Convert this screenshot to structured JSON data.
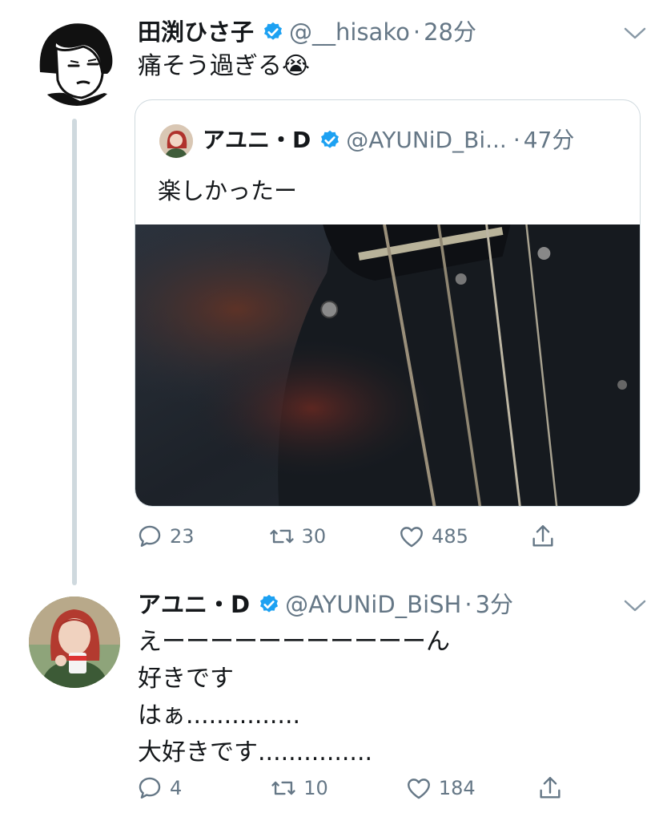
{
  "tweets": [
    {
      "name": "田渕ひさ子",
      "handle": "@__hisako",
      "dot": "·",
      "time": "28分",
      "text": "痛そう過ぎる😭",
      "counts": {
        "reply": "23",
        "retweet": "30",
        "like": "485"
      },
      "quote": {
        "name": "アユニ・D",
        "handle": "@AYUNiD_Bi...",
        "dot": "·",
        "time": "47分",
        "text": "楽しかったー"
      }
    },
    {
      "name": "アユニ・D",
      "handle": "@AYUNiD_BiSH",
      "dot": "·",
      "time": "3分",
      "lines": [
        "えーーーーーーーーーーーん",
        "好きです",
        "はぁ...............",
        "大好きです..............."
      ],
      "counts": {
        "reply": "4",
        "retweet": "10",
        "like": "184"
      }
    }
  ],
  "colors": {
    "verified": "#1da1f2",
    "muted": "#657786",
    "thread": "#cfd9de"
  },
  "icons": [
    "verified-badge-icon",
    "chevron-down-icon",
    "reply-icon",
    "retweet-icon",
    "like-icon",
    "share-icon"
  ]
}
